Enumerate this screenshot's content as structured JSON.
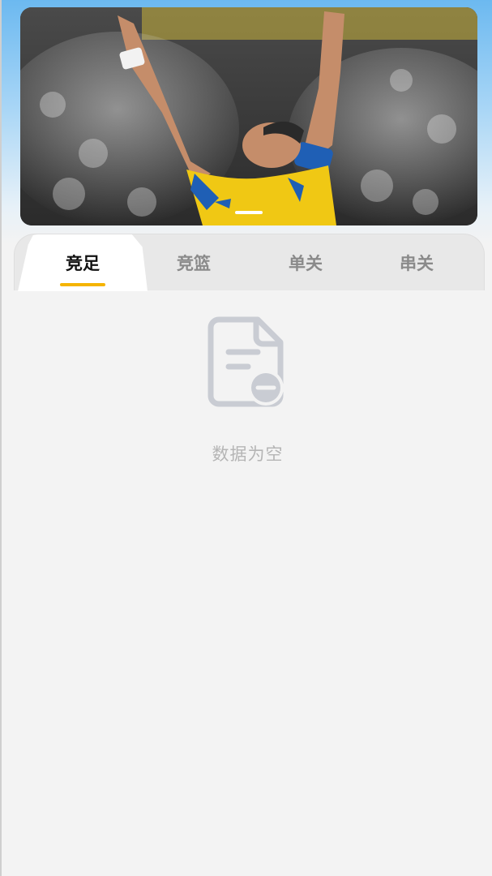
{
  "banner": {
    "image": "football-player-celebrating-image",
    "slides": 2,
    "active_slide": 1
  },
  "tabs": [
    {
      "label": "竞足",
      "active": true
    },
    {
      "label": "竞篮",
      "active": false
    },
    {
      "label": "单关",
      "active": false
    },
    {
      "label": "串关",
      "active": false
    }
  ],
  "empty_state": {
    "icon": "empty-document-icon",
    "message": "数据为空"
  },
  "colors": {
    "accent": "#f5b400",
    "muted_text": "#b5b5b5",
    "sky_top": "#6cb9f0"
  }
}
